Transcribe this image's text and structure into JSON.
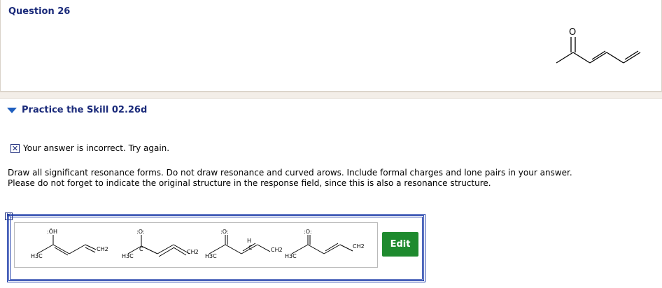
{
  "question": {
    "title": "Question 26"
  },
  "question_structure": {
    "atom_label": "O"
  },
  "practice": {
    "title": "Practice the Skill 02.26d",
    "feedback_icon": "x-mark-icon",
    "feedback": "Your answer is incorrect.  Try again.",
    "instructions_line1": "Draw all significant resonance forms. Do not draw resonance and curved arows. Include formal charges and lone pairs in your answer.",
    "instructions_line2": "Please do not forget to indicate the original structure in the response field, since this is also a resonance structure."
  },
  "answer": {
    "structures": [
      {
        "top_label": ":ÖH",
        "left_label": "H3C",
        "right_label": "CH2"
      },
      {
        "top_label": ":O:",
        "left_label": "H3C",
        "right_label": "CH2",
        "charge_label": "C"
      },
      {
        "top_label": ":O:",
        "left_label": "H3C",
        "right_label": "CH2",
        "charge_label": "C",
        "h_label": "H"
      },
      {
        "top_label": ":O:",
        "left_label": "H3C",
        "right_label": "CH2"
      }
    ],
    "edit_label": "Edit"
  },
  "colors": {
    "title_blue": "#1a2a7a",
    "edit_green": "#1e8a2e",
    "border_blue": "#1a3aa8"
  }
}
